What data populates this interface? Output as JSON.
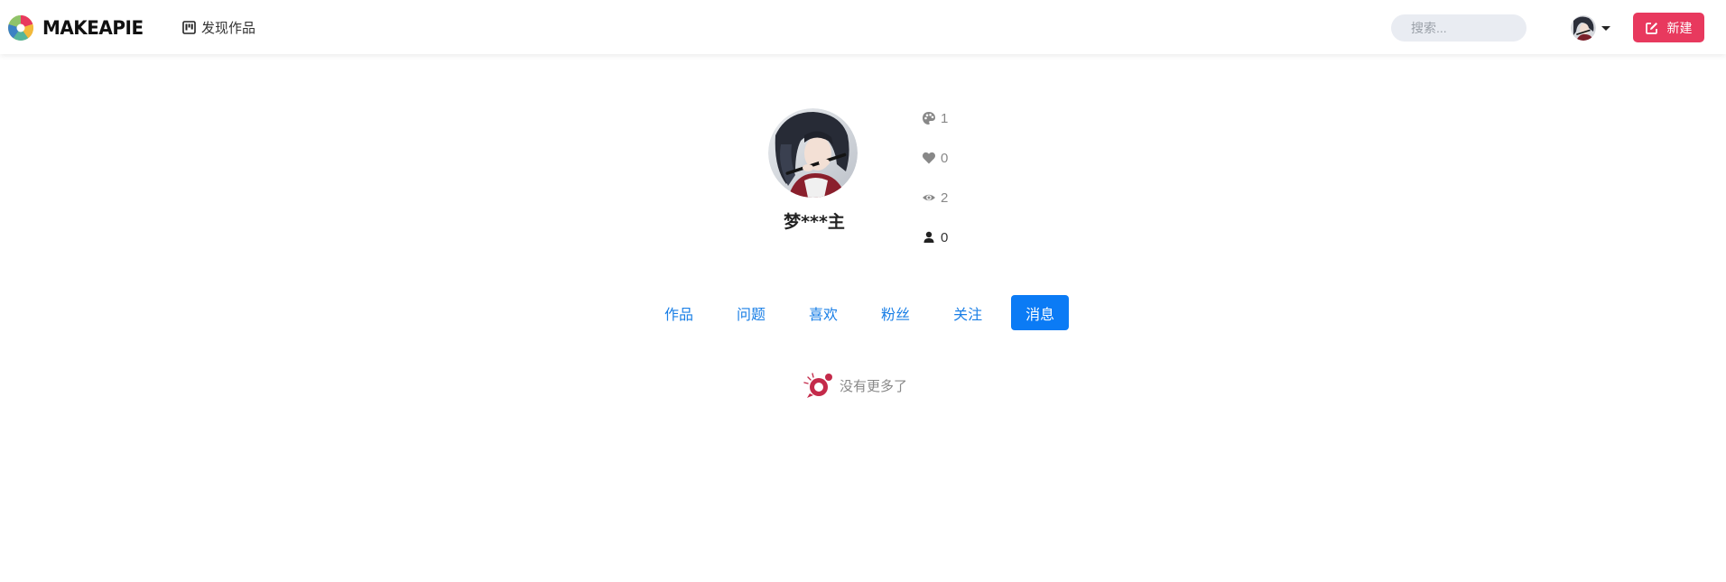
{
  "brand": {
    "name": "MAKEAPIE"
  },
  "nav": {
    "discover_label": "发现作品"
  },
  "search": {
    "placeholder": "搜索..."
  },
  "header": {
    "new_button_label": "新建"
  },
  "profile": {
    "name": "梦***主",
    "stats": {
      "works": "1",
      "likes": "0",
      "views": "2",
      "followers": "0"
    }
  },
  "tabs": [
    {
      "label": "作品",
      "active": false
    },
    {
      "label": "问题",
      "active": false
    },
    {
      "label": "喜欢",
      "active": false
    },
    {
      "label": "粉丝",
      "active": false
    },
    {
      "label": "关注",
      "active": false
    },
    {
      "label": "消息",
      "active": true
    }
  ],
  "empty_state": {
    "text": "没有更多了"
  },
  "icons": {
    "logo": "makeapie-logo-icon",
    "discover": "kanban-icon",
    "new": "edit-icon",
    "works": "palette-icon",
    "likes": "heart-icon",
    "views": "eye-icon",
    "followers": "user-icon",
    "empty": "empty-bubble-icon"
  },
  "colors": {
    "accent_red": "#e8395e",
    "tab_blue": "#1a7fe6",
    "tab_active_bg": "#0b7bf5",
    "search_bg": "#e9ecf2"
  }
}
